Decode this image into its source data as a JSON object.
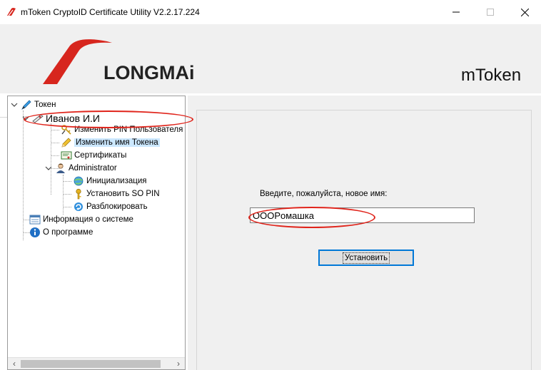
{
  "window": {
    "title": "mToken CryptoID Certificate Utility  V2.2.17.224",
    "icons": {
      "app": "mtoken-logo-icon",
      "minimize": "minimize-icon",
      "maximize": "maximize-icon",
      "close": "close-icon"
    }
  },
  "banner": {
    "logo_text": "LONGMAi",
    "brand_text": "mToken"
  },
  "tree": {
    "items": [
      {
        "label": "Токен",
        "icon": "pen-token-icon"
      },
      {
        "label": "Иванов И.И",
        "icon": "token-key-icon"
      },
      {
        "label": "Изменить PIN Пользователя",
        "icon": "keys-icon"
      },
      {
        "label": "Изменить имя Токена",
        "icon": "pencil-icon",
        "selected": true
      },
      {
        "label": "Сертификаты",
        "icon": "certificate-icon"
      },
      {
        "label": "Administrator",
        "icon": "admin-user-icon"
      },
      {
        "label": "Инициализация",
        "icon": "init-globe-icon"
      },
      {
        "label": "Установить SO PIN",
        "icon": "key-icon"
      },
      {
        "label": "Разблокировать",
        "icon": "unlock-icon"
      },
      {
        "label": "Информация о системе",
        "icon": "system-info-icon"
      },
      {
        "label": "О программе",
        "icon": "info-icon"
      }
    ]
  },
  "form": {
    "prompt": "Введите, пожалуйста, новое имя:",
    "name_value": "OOOPомашка",
    "set_button": "Установить"
  },
  "colors": {
    "accent": "#0078d7",
    "annotation": "#e0241b",
    "logo_red": "#d7261e"
  }
}
